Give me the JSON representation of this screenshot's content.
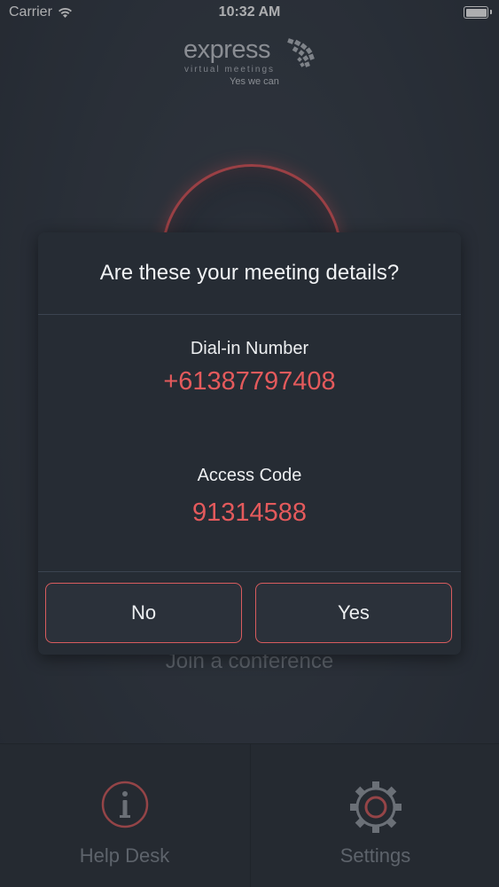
{
  "status_bar": {
    "carrier": "Carrier",
    "time": "10:32 AM",
    "battery_level": 1.0
  },
  "logo": {
    "word": "express",
    "subtitle": "virtual meetings",
    "tagline": "Yes we can"
  },
  "main": {
    "join_label": "Join a conference"
  },
  "dialog": {
    "title": "Are these your meeting details?",
    "dial_in_label": "Dial-in Number",
    "dial_in_value": "+61387797408",
    "access_code_label": "Access Code",
    "access_code_value": "91314588",
    "no_label": "No",
    "yes_label": "Yes"
  },
  "tab_bar": {
    "help_label": "Help Desk",
    "help_icon": "info-icon",
    "settings_label": "Settings",
    "settings_icon": "gear-icon"
  },
  "colors": {
    "accent": "#e45a5c",
    "background": "#353c46",
    "dialog_background": "#262c34"
  }
}
